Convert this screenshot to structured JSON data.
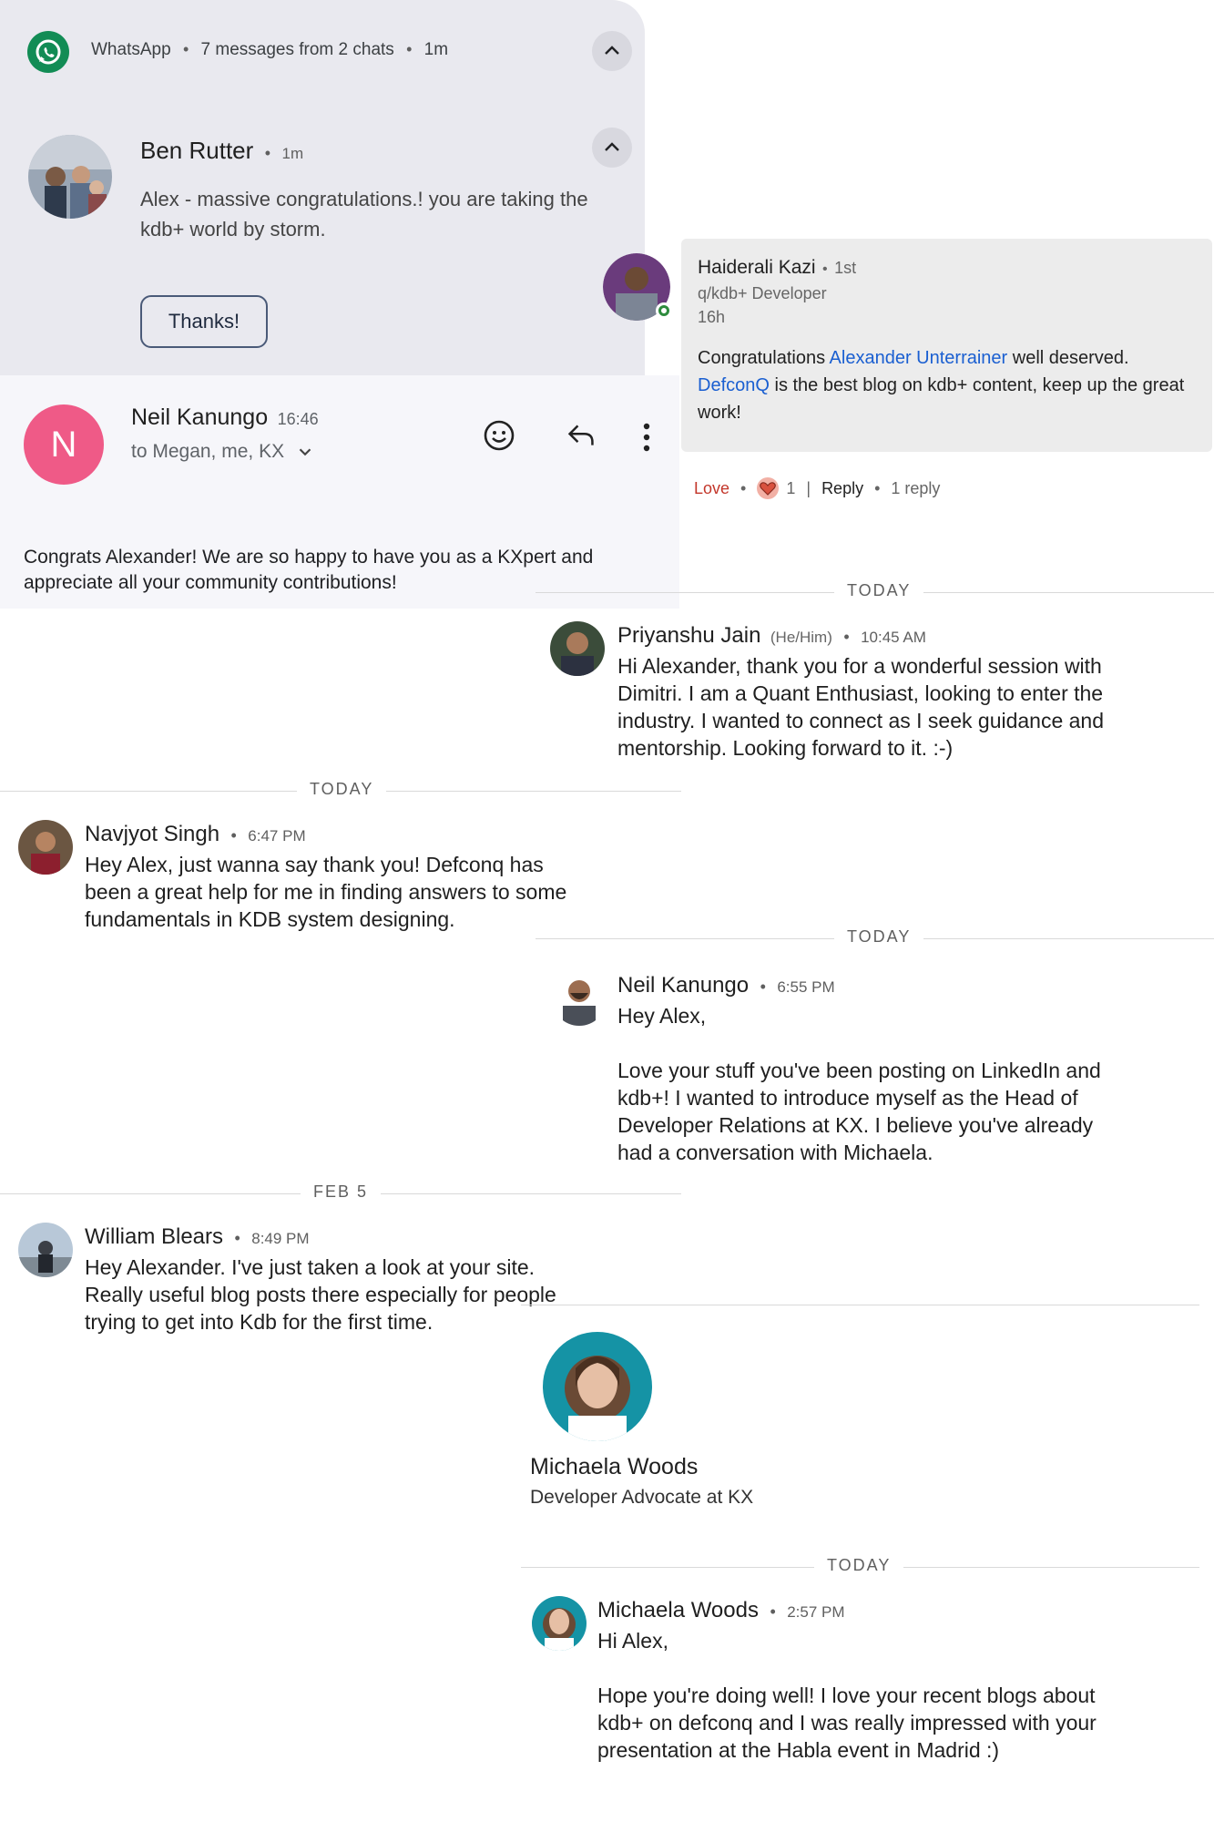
{
  "whatsapp": {
    "header": "WhatsApp",
    "summary": "7 messages from 2 chats",
    "age": "1m",
    "sender": "Ben Rutter",
    "sender_age": "1m",
    "message": "Alex - massive congratulations.! you are taking the kdb+ world by storm.",
    "reply_button": "Thanks!",
    "accent": "#128c55"
  },
  "gmail": {
    "avatar_letter": "N",
    "avatar_color": "#ef5a87",
    "sender": "Neil Kanungo",
    "time": "16:46",
    "recipients": "to Megan, me, KX",
    "body": "Congrats Alexander! We are so happy to have you as a KXpert and appreciate all your community contributions!"
  },
  "linkedin_comment": {
    "author": "Haiderali Kazi",
    "degree": "1st",
    "headline": "q/kdb+ Developer",
    "age": "16h",
    "text_1": "Congratulations",
    "mention_1": "Alexander Unterrainer",
    "text_2": "well deserved.",
    "mention_2": "DefconQ",
    "text_3": "is the best blog on kdb+ content, keep up the great work!",
    "reaction_label": "Love",
    "reaction_count": "1",
    "reply_label": "Reply",
    "replies": "1 reply"
  },
  "messages": [
    {
      "divider": "TODAY",
      "author": "Priyanshu Jain",
      "pronouns": "(He/Him)",
      "time": "10:45 AM",
      "lines": [
        "Hi Alexander, thank you for a wonderful session with",
        "Dimitri. I am a Quant Enthusiast, looking to enter the",
        "industry. I wanted to connect as I seek guidance and",
        "mentorship. Looking forward to it.  :-)"
      ]
    },
    {
      "divider": "TODAY",
      "author": "Navjyot Singh",
      "time": "6:47 PM",
      "lines": [
        "Hey Alex, just wanna say thank you! Defconq has",
        "been a great help for me in finding answers to some",
        "fundamentals in KDB system designing."
      ]
    },
    {
      "divider": "TODAY",
      "author": "Neil Kanungo",
      "time": "6:55 PM",
      "lines": [
        "Hey Alex,",
        "",
        "Love your stuff you've been posting on LinkedIn and",
        "kdb+! I wanted to introduce myself as the Head of",
        "Developer Relations at KX. I believe you've already",
        "had a conversation with Michaela."
      ]
    },
    {
      "divider": "FEB 5",
      "author": "William Blears",
      "time": "8:49 PM",
      "lines": [
        "Hey Alexander. I've just taken a look at your site.",
        "Really useful blog posts there especially for people",
        "trying to get into Kdb for the first time."
      ]
    },
    {
      "divider": "TODAY",
      "author": "Michaela Woods",
      "time": "2:57 PM",
      "lines": [
        "Hi Alex,",
        "",
        "Hope you're doing well! I love your recent blogs about",
        "kdb+ on defconq and I was really impressed with your",
        "presentation at the Habla event in Madrid :)"
      ]
    }
  ],
  "profile": {
    "name": "Michaela Woods",
    "title": "Developer Advocate at KX"
  }
}
